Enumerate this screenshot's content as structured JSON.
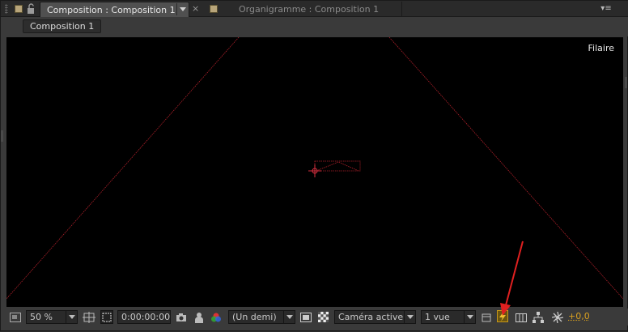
{
  "tabs": {
    "active_label": "Composition : Composition 1",
    "inactive_label": "Organigramme : Composition 1",
    "close_glyph": "×",
    "menu_glyph": "▾≡"
  },
  "breadcrumb": {
    "label": "Composition 1"
  },
  "viewer": {
    "mode_label": "Filaire",
    "background": "#000000",
    "wire_color": "#b0202a"
  },
  "toolbar": {
    "magnification": "50 %",
    "timecode": "0:00:00:00",
    "resolution": "(Un demi)",
    "camera": "Caméra active",
    "views": "1 vue",
    "exposure": "+0,0"
  },
  "annotation": {
    "arrow_color": "#e02020"
  },
  "colors": {
    "accent": "#d8a020",
    "panel": "#3a3a3a"
  }
}
